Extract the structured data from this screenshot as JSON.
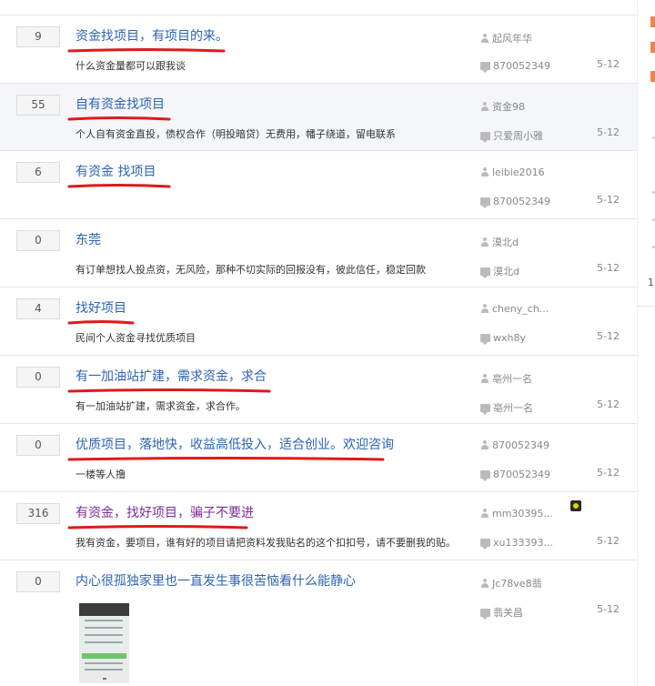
{
  "threads": [
    {
      "count": "9",
      "title": "资金找项目，有项目的来。",
      "desc": "什么资金量都可以跟我谈",
      "author": "起风年华",
      "last_reply": "870052349",
      "date": "5-12",
      "visited": false,
      "highlight": false,
      "underline": true,
      "badge": false,
      "thumbnail": false
    },
    {
      "count": "55",
      "title": "自有资金找项目",
      "desc": "个人自有资金直投，债权合作（明投暗贷）无费用，幡子绕道，留电联系",
      "author": "资金98",
      "last_reply": "只爱周小雅",
      "date": "5-12",
      "visited": false,
      "highlight": true,
      "underline": true,
      "badge": false,
      "thumbnail": false
    },
    {
      "count": "6",
      "title": "有资金 找项目",
      "desc": "",
      "author": "leibie2016",
      "last_reply": "870052349",
      "date": "5-12",
      "visited": false,
      "highlight": false,
      "underline": true,
      "badge": false,
      "thumbnail": false
    },
    {
      "count": "0",
      "title": "东莞",
      "desc": "有订单想找人投点资，无风险，那种不切实际的回报没有，彼此信任，稳定回款",
      "author": "漠北d",
      "last_reply": "漠北d",
      "date": "5-12",
      "visited": false,
      "highlight": false,
      "underline": false,
      "badge": false,
      "thumbnail": false
    },
    {
      "count": "4",
      "title": "找好项目",
      "desc": "民间个人资金寻找优质项目",
      "author": "cheny_ch...",
      "last_reply": "wxh8y",
      "date": "5-12",
      "visited": false,
      "highlight": false,
      "underline": true,
      "badge": false,
      "thumbnail": false
    },
    {
      "count": "0",
      "title": "有一加油站扩建，需求资金，求合",
      "desc": "有一加油站扩建，需求资金，求合作。",
      "author": "亳州一名",
      "last_reply": "亳州一名",
      "date": "5-12",
      "visited": false,
      "highlight": false,
      "underline": true,
      "badge": false,
      "thumbnail": false
    },
    {
      "count": "0",
      "title": "优质项目，落地快，收益高低投入，适合创业。欢迎咨询",
      "desc": "一楼等人撸",
      "author": "870052349",
      "last_reply": "870052349",
      "date": "5-12",
      "visited": false,
      "highlight": false,
      "underline": true,
      "badge": false,
      "thumbnail": false
    },
    {
      "count": "316",
      "title": "有资金，找好项目，骗子不要进",
      "desc": "我有资金，要项目，谁有好的项目请把资料发我贴名的这个扣扣号，请不要删我的贴。",
      "author": "mm30395...",
      "last_reply": "xu133393...",
      "date": "5-12",
      "visited": true,
      "highlight": false,
      "underline": true,
      "badge": true,
      "thumbnail": false
    },
    {
      "count": "0",
      "title": "内心很孤独家里也一直发生事很苦恼看什么能静心",
      "desc": "",
      "author": "Jc78ve8翡",
      "last_reply": "翡关昌",
      "date": "5-12",
      "visited": false,
      "highlight": false,
      "underline": false,
      "badge": false,
      "thumbnail": true
    }
  ],
  "sidebar": {
    "text": "1("
  },
  "colors": {
    "link": "#2d64b3",
    "visited_link": "#7b2c9e",
    "underline_mark": "#e01a1a",
    "accent_orange": "#f0854a"
  }
}
